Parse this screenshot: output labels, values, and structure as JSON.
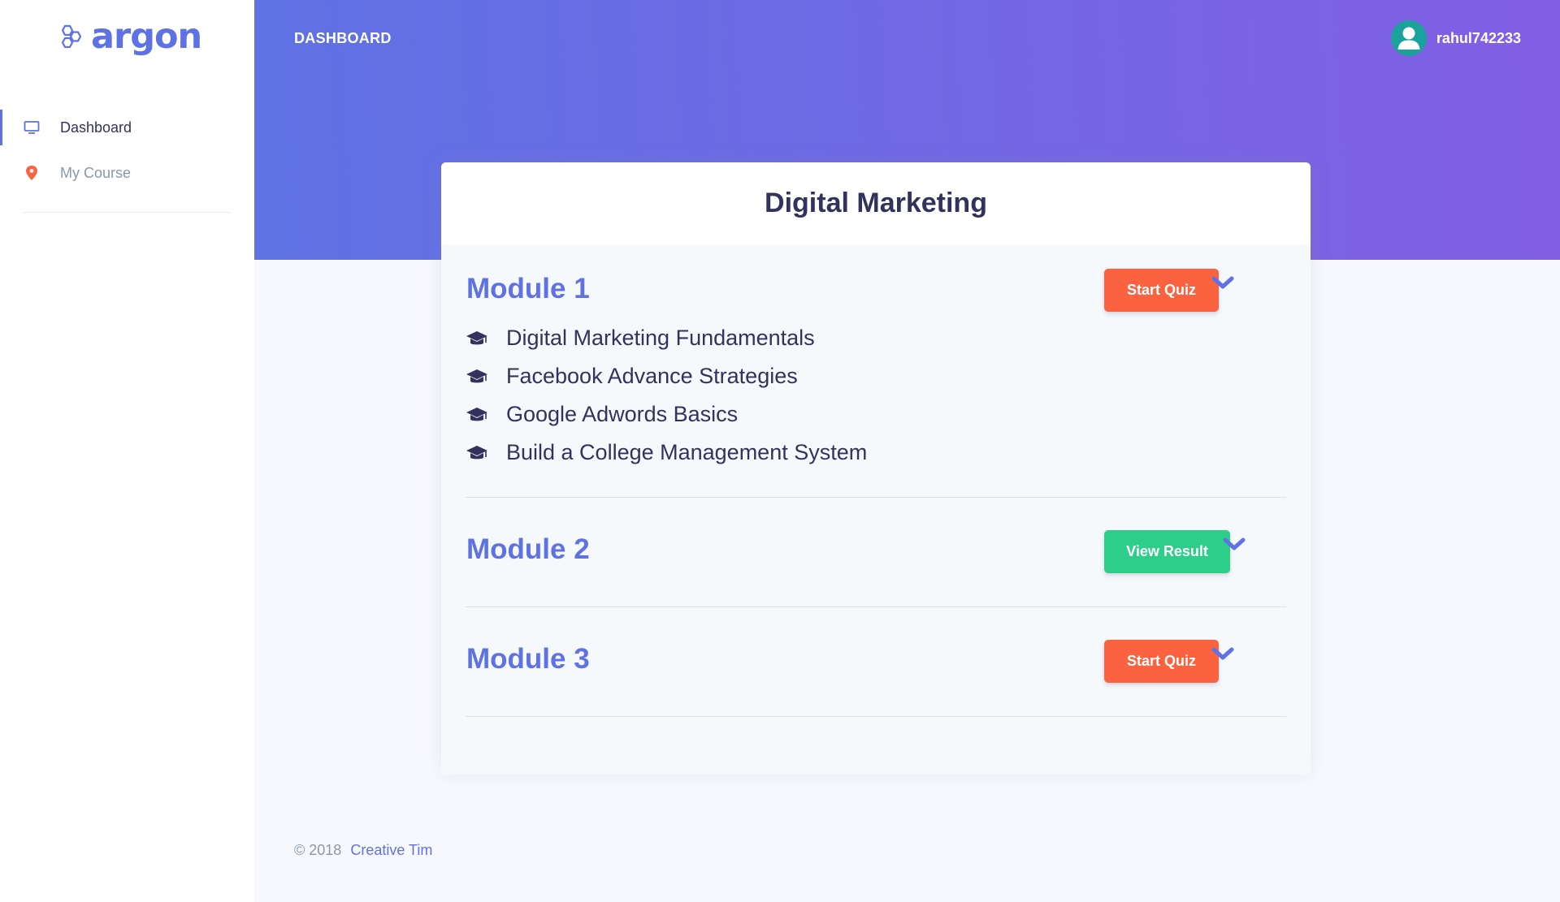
{
  "brand": {
    "name": "argon",
    "icon": "hexagon-logo-icon"
  },
  "sidebar": {
    "items": [
      {
        "label": "Dashboard",
        "icon": "monitor-icon",
        "active": true
      },
      {
        "label": "My Course",
        "icon": "map-pin-icon",
        "active": false
      }
    ]
  },
  "header": {
    "title": "DASHBOARD",
    "username": "rahul742233",
    "avatar_icon": "user-avatar-icon"
  },
  "course": {
    "title": "Digital Marketing",
    "modules": [
      {
        "title": "Module 1",
        "action": "Start Quiz",
        "topics": [
          "Digital Marketing Fundamentals",
          "Facebook Advance Strategies",
          "Google Adwords Basics",
          "Build a College Management System"
        ]
      },
      {
        "title": "Module 2",
        "action": "View Result"
      },
      {
        "title": "Module 3",
        "action": "Start Quiz"
      }
    ]
  },
  "footer": {
    "copyright": "© 2018",
    "link": "Creative Tim"
  },
  "colors": {
    "primary": "#5e72e4",
    "gradient_end": "#825ee4",
    "orange": "#fb6340",
    "green": "#2dce89",
    "text": "#32325d",
    "muted": "#8898aa"
  }
}
